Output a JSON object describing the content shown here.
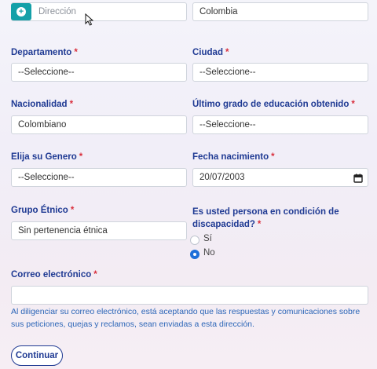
{
  "direccion": {
    "placeholder": "Dirección"
  },
  "pais": {
    "value": "Colombia"
  },
  "departamento": {
    "label": "Departamento",
    "value": "--Seleccione--"
  },
  "ciudad": {
    "label": "Ciudad",
    "value": "--Seleccione--"
  },
  "nacionalidad": {
    "label": "Nacionalidad",
    "value": "Colombiano"
  },
  "educacion": {
    "label": "Último grado de educación obtenido",
    "value": "--Seleccione--"
  },
  "genero": {
    "label": "Elija su Genero",
    "value": "--Seleccione--"
  },
  "fecha_nacimiento": {
    "label": "Fecha nacimiento",
    "value": "20/07/2003"
  },
  "grupo_etnico": {
    "label": "Grupo Étnico",
    "value": "Sin pertenencia étnica"
  },
  "discapacidad": {
    "label_line1": "Es usted persona en condición de",
    "label_line2": "discapacidad?",
    "options": [
      {
        "label": "Sí",
        "selected": false
      },
      {
        "label": "No",
        "selected": true
      }
    ]
  },
  "correo": {
    "label": "Correo electrónico",
    "value": "",
    "helper": "Al diligenciar su correo electrónico, está aceptando que las respuestas y comunicaciones sobre sus peticiones, quejas y reclamos, sean enviadas a esta dirección."
  },
  "required_mark": "*",
  "continuar_button": {
    "label": "Continuar"
  },
  "colors": {
    "label_blue": "#1f3a93",
    "required_red": "#d9303e",
    "accent_teal": "#14a0a8",
    "radio_blue": "#1e6fd9",
    "helper_blue": "#2c66b8"
  },
  "icons": {
    "address_add": "plus-circle-icon",
    "calendar": "calendar-icon",
    "cursor": "mouse-cursor-icon"
  }
}
